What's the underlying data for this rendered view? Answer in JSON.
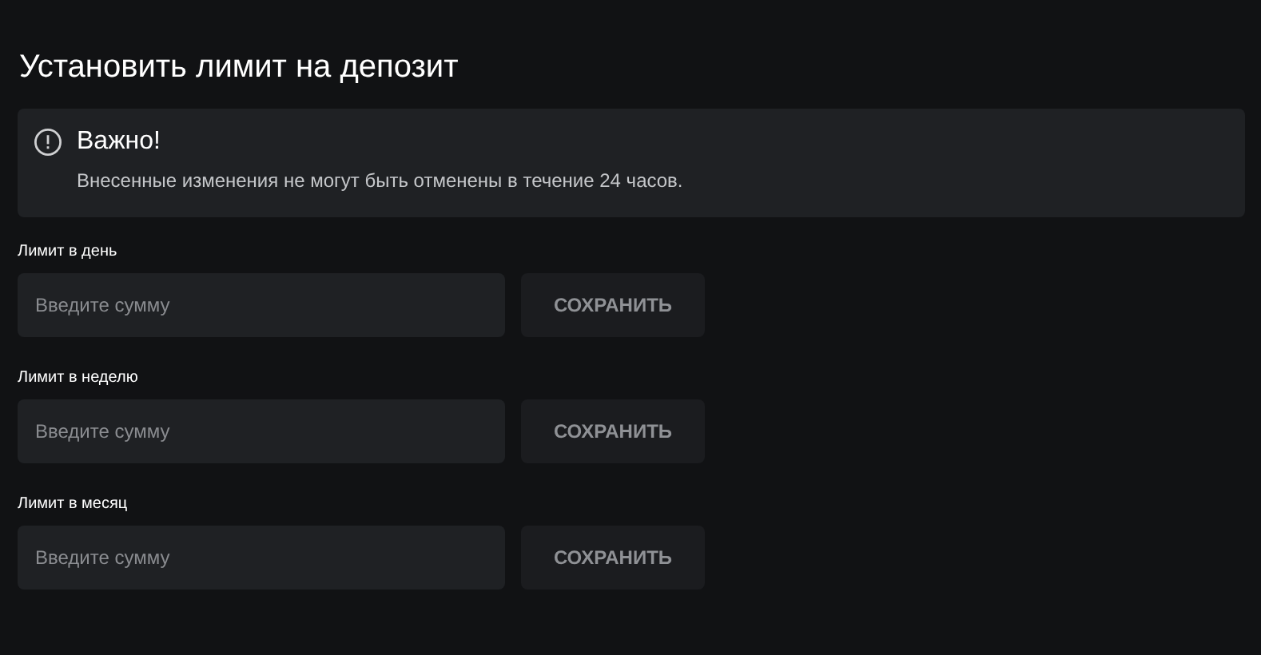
{
  "title": "Установить лимит на депозит",
  "notice": {
    "heading": "Важно!",
    "text": "Внесенные изменения не могут быть отменены в течение 24 часов."
  },
  "limits": [
    {
      "label": "Лимит в день",
      "placeholder": "Введите сумму",
      "button": "СОХРАНИТЬ"
    },
    {
      "label": "Лимит в неделю",
      "placeholder": "Введите сумму",
      "button": "СОХРАНИТЬ"
    },
    {
      "label": "Лимит в месяц",
      "placeholder": "Введите сумму",
      "button": "СОХРАНИТЬ"
    }
  ]
}
